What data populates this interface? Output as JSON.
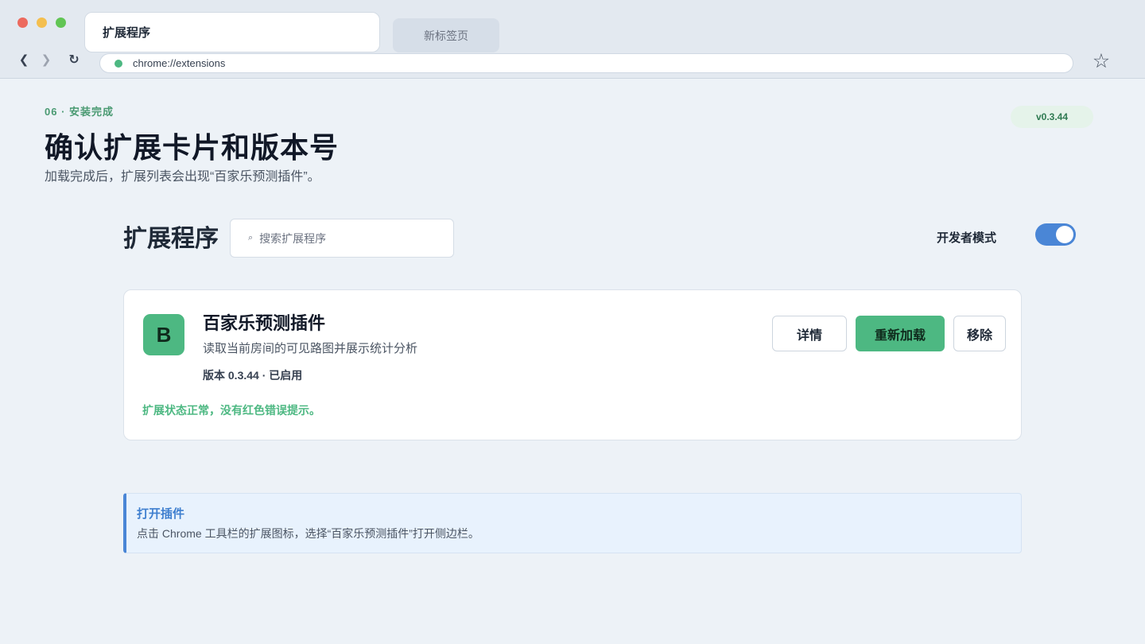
{
  "browser": {
    "tabs": [
      {
        "label": "扩展程序",
        "active": true
      },
      {
        "label": "新标签页",
        "active": false
      }
    ],
    "nav": {
      "back_icon": "❮",
      "forward_icon": "❯",
      "reload_icon": "↻"
    },
    "url": "chrome://extensions",
    "star_icon": "☆"
  },
  "header": {
    "step": "06 · 安装完成",
    "title": "确认扩展卡片和版本号",
    "subtitle": "加载完成后，扩展列表会出现“百家乐预测插件”。",
    "version_badge": "v0.3.44"
  },
  "extensions_page": {
    "heading": "扩展程序",
    "search_icon": "⌕",
    "search_placeholder": "搜索扩展程序",
    "dev_mode_label": "开发者模式",
    "dev_mode_on": true
  },
  "extension_card": {
    "icon_letter": "B",
    "name": "百家乐预测插件",
    "description": "读取当前房间的可见路图并展示统计分析",
    "version_line": "版本 0.3.44 · 已启用",
    "status": "扩展状态正常，没有红色错误提示。",
    "buttons": {
      "details": "详情",
      "reload": "重新加载",
      "remove": "移除"
    }
  },
  "info": {
    "title": "打开插件",
    "text": "点击 Chrome 工具栏的扩展图标，选择“百家乐预测插件”打开侧边栏。"
  },
  "colors": {
    "accent_green": "#4db882",
    "accent_blue": "#4a86d6",
    "background": "#edf2f7"
  }
}
